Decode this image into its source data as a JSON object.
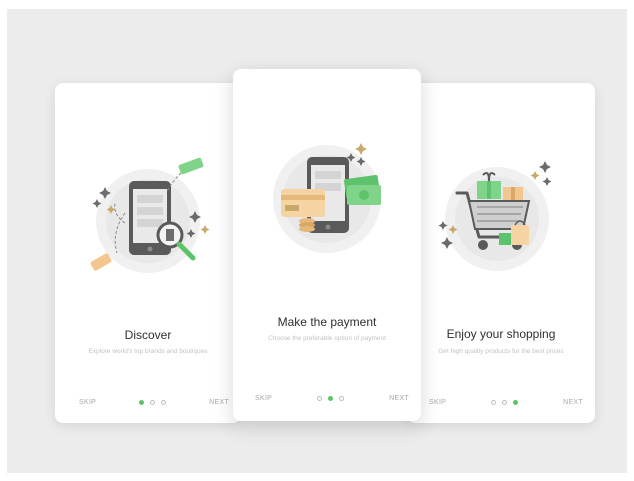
{
  "colors": {
    "accent": "#5dc26b",
    "background": "#ececec",
    "card": "#ffffff"
  },
  "cards": [
    {
      "title": "Discover",
      "description": "Explore world's top brands and boutiques",
      "skip_label": "SKIP",
      "next_label": "NEXT",
      "active_dot": 0,
      "illustration_icon": "phone-search-icon"
    },
    {
      "title": "Make the payment",
      "description": "Choose the preferable option of payment",
      "skip_label": "SKIP",
      "next_label": "NEXT",
      "active_dot": 1,
      "illustration_icon": "phone-payment-icon"
    },
    {
      "title": "Enjoy your shopping",
      "description": "Get high quality products for the best prices",
      "skip_label": "SKIP",
      "next_label": "NEXT",
      "active_dot": 2,
      "illustration_icon": "shopping-cart-icon"
    }
  ]
}
